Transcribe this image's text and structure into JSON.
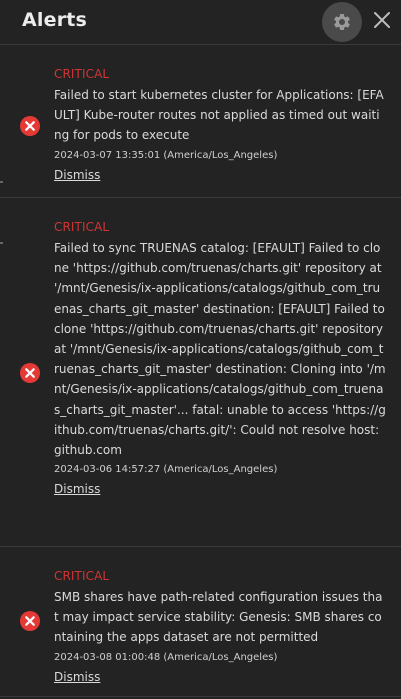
{
  "panel": {
    "title": "Alerts"
  },
  "alerts": [
    {
      "level": "CRITICAL",
      "message": "Failed to start kubernetes cluster for Applications: [EFAULT] Kube-router routes not applied as timed out waiting for pods to execute",
      "timestamp": "2024-03-07 13:35:01 (America/Los_Angeles)",
      "dismiss_label": "Dismiss"
    },
    {
      "level": "CRITICAL",
      "message": "Failed to sync TRUENAS catalog: [EFAULT] Failed to clone 'https://github.com/truenas/charts.git' repository at '/mnt/Genesis/ix-applications/catalogs/github_com_truenas_charts_git_master' destination: [EFAULT] Failed to clone 'https://github.com/truenas/charts.git' repository at '/mnt/Genesis/ix-applications/catalogs/github_com_truenas_charts_git_master' destination: Cloning into '/mnt/Genesis/ix-applications/catalogs/github_com_truenas_charts_git_master'... fatal: unable to access 'https://github.com/truenas/charts.git/': Could not resolve host: github.com",
      "timestamp": "2024-03-06 14:57:27 (America/Los_Angeles)",
      "dismiss_label": "Dismiss"
    },
    {
      "level": "CRITICAL",
      "message": "SMB shares have path-related configuration issues that may impact service stability: Genesis: SMB shares containing the apps dataset are not permitted",
      "timestamp": "2024-03-08 01:00:48 (America/Los_Angeles)",
      "dismiss_label": "Dismiss"
    }
  ],
  "colors": {
    "background": "#232323",
    "critical": "#d13434",
    "text": "#dadada",
    "icon_red": "#e53935"
  },
  "icons": {
    "settings": "gear-icon",
    "close": "close-icon",
    "alert": "error-circle-icon"
  }
}
